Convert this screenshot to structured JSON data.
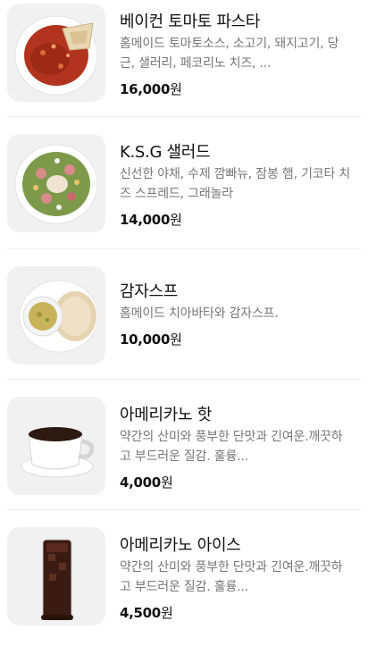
{
  "menu": {
    "items": [
      {
        "name": "베이컨 토마토 파스타",
        "description": "홈메이드 토마토소스, 소고기, 돼지고기, 당근, 샐러리, 페코리노 치즈, ...",
        "price": "16,000",
        "currency": "원",
        "image_icon": "pasta-dish-image"
      },
      {
        "name": "K.S.G 샐러드",
        "description": "신선한 야채, 수제 깜빠뉴, 잠봉 햄, 기코타 치즈 스프레드, 그래놀라",
        "price": "14,000",
        "currency": "원",
        "image_icon": "salad-dish-image"
      },
      {
        "name": "감자스프",
        "description": "홈메이드 치아바타와 감자스프.",
        "price": "10,000",
        "currency": "원",
        "image_icon": "potato-soup-image"
      },
      {
        "name": "아메리카노 핫",
        "description": "약간의 산미와 풍부한 단맛과 긴여운.깨끗하고 부드러운 질감. 훌륭...",
        "price": "4,000",
        "currency": "원",
        "image_icon": "hot-coffee-cup-image"
      },
      {
        "name": "아메리카노 아이스",
        "description": "약간의 산미와 풍부한 단맛과 긴여운.깨끗하고 부드러운 질감. 훌륭...",
        "price": "4,500",
        "currency": "원",
        "image_icon": "iced-coffee-glass-image"
      }
    ]
  }
}
